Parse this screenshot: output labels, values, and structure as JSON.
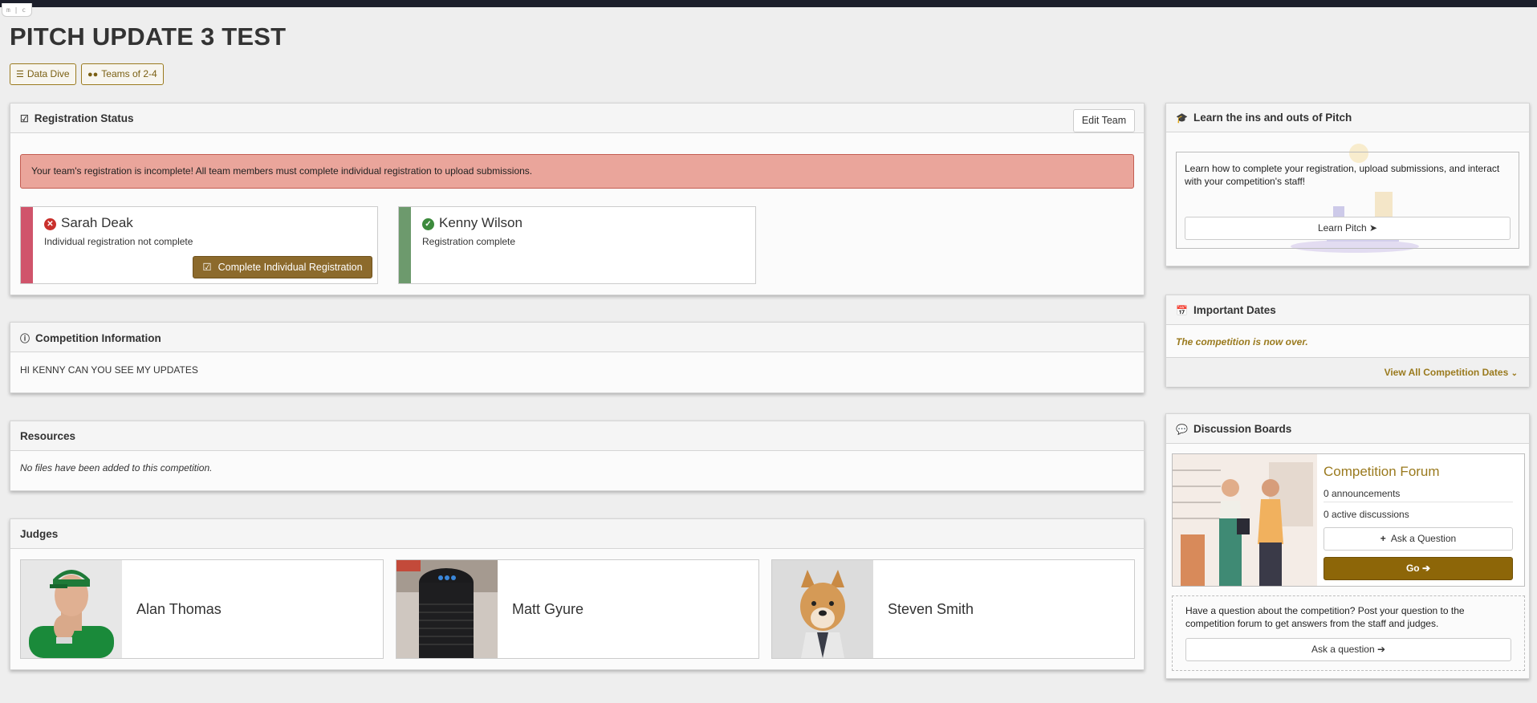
{
  "browser_tab": "m | c",
  "page_title": "PITCH UPDATE 3 TEST",
  "tags": [
    {
      "icon": "database-icon",
      "label": "Data Dive"
    },
    {
      "icon": "users-icon",
      "label": "Teams of 2-4"
    }
  ],
  "registration": {
    "title": "Registration Status",
    "edit_button": "Edit Team",
    "alert": "Your team's registration is incomplete! All team members must complete individual registration to upload submissions.",
    "members": [
      {
        "name": "Sarah Deak",
        "status": "Individual registration not complete",
        "state": "incomplete",
        "color": "#d0546b"
      },
      {
        "name": "Kenny Wilson",
        "status": "Registration complete",
        "state": "complete",
        "color": "#6d9a6d"
      }
    ],
    "complete_button": "Complete Individual Registration"
  },
  "competition_info": {
    "title": "Competition Information",
    "text": "HI KENNY CAN YOU SEE MY UPDATES"
  },
  "resources": {
    "title": "Resources",
    "empty_text": "No files have been added to this competition."
  },
  "judges": {
    "title": "Judges",
    "items": [
      {
        "name": "Alan Thomas"
      },
      {
        "name": "Matt Gyure"
      },
      {
        "name": "Steven Smith"
      }
    ]
  },
  "learn": {
    "title": "Learn the ins and outs of Pitch",
    "text": "Learn how to complete your registration, upload submissions, and interact with your competition's staff!",
    "button": "Learn Pitch"
  },
  "dates": {
    "title": "Important Dates",
    "notice": "The competition is now over.",
    "link": "View All Competition Dates"
  },
  "discussion": {
    "title": "Discussion Boards",
    "forum_title": "Competition Forum",
    "announcements": "0 announcements",
    "discussions": "0 active discussions",
    "ask_button": "Ask a Question",
    "go_button": "Go",
    "question_text": "Have a question about the competition? Post your question to the competition forum to get answers from the staff and judges.",
    "ask_link": "Ask a question"
  },
  "colors": {
    "accent": "#9a7a1e",
    "alert_bg": "#eaa59b",
    "brown_button": "#8c6a2c",
    "go_button": "#8d6608"
  }
}
